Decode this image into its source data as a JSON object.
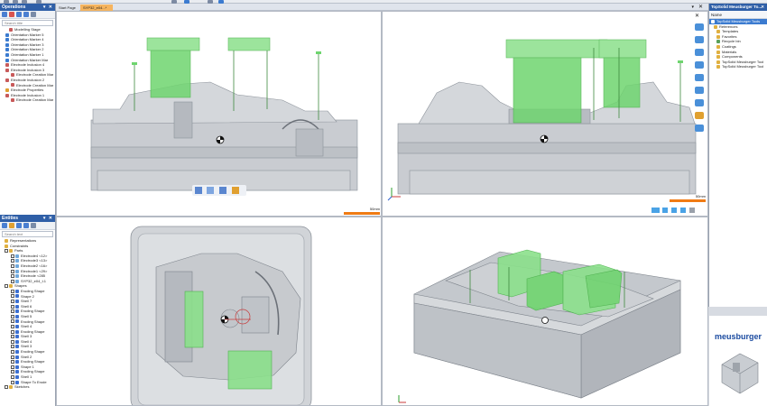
{
  "document_tabs": [
    {
      "label": "Start Page"
    },
    {
      "label": "SYP32_e04...*"
    }
  ],
  "operations_panel": {
    "title": "Operations",
    "search_placeholder": "Search title",
    "items": [
      "Modelling Stage",
      "Orientation Marker 5",
      "Orientation Marker 4",
      "Orientation Marker 3",
      "Orientation Marker 2",
      "Orientation Marker 1",
      "Orientation Marker Mar",
      "Electrode Inclusion 4",
      "Electrode Inclusion 3",
      "Electrode Creation Mar",
      "Electrode Inclusion 2",
      "Electrode Creation Mar",
      "Electrode Properties",
      "Electrode Inclusion 1",
      "Electrode Creation Mar"
    ]
  },
  "entities_panel": {
    "title": "Entities",
    "search_placeholder": "Search text",
    "items": [
      "Representations",
      "Constraints",
      "Parts",
      "Electrode4 <12>",
      "Electrode3 <13>",
      "Electrode2 <16>",
      "Electrode1 <29>",
      "Electrode <285",
      "SYP32_e04_t.1",
      "Shapes",
      "Eroding Shape",
      "Shape 2",
      "Shell 7",
      "Shell 6",
      "Eroding Shape",
      "Shell 5",
      "Eroding Shape",
      "Shell 4",
      "Eroding Shape",
      "Shell 3",
      "Shell 4",
      "Shell 3",
      "Eroding Shape",
      "Shell 2",
      "Eroding Shape",
      "Shape 1",
      "Eroding Shape",
      "Shell 1",
      "Shape To Erode",
      "Sketches"
    ]
  },
  "library_panel": {
    "title": "TopSolid Meusburger To...",
    "column_header": "Name",
    "items": [
      "TopSolid Meusburger Tools",
      "References",
      "Templates",
      "Favorites",
      "Recycle bin",
      "Coatings",
      "Materials",
      "Components",
      "TopSolid Meusburger Tool",
      "TopSolid Meusburger Tool"
    ]
  },
  "viewports": {
    "top_left": {
      "scale_label": "50mm"
    },
    "top_right": {
      "scale_label": "50mm"
    }
  },
  "logo": {
    "text": "meusburger"
  },
  "colors": {
    "accent_blue": "#2f5fa7",
    "electrode_green": "#5fd35f",
    "scale_orange": "#f07b14",
    "model_grey": "#bfc3c9"
  }
}
